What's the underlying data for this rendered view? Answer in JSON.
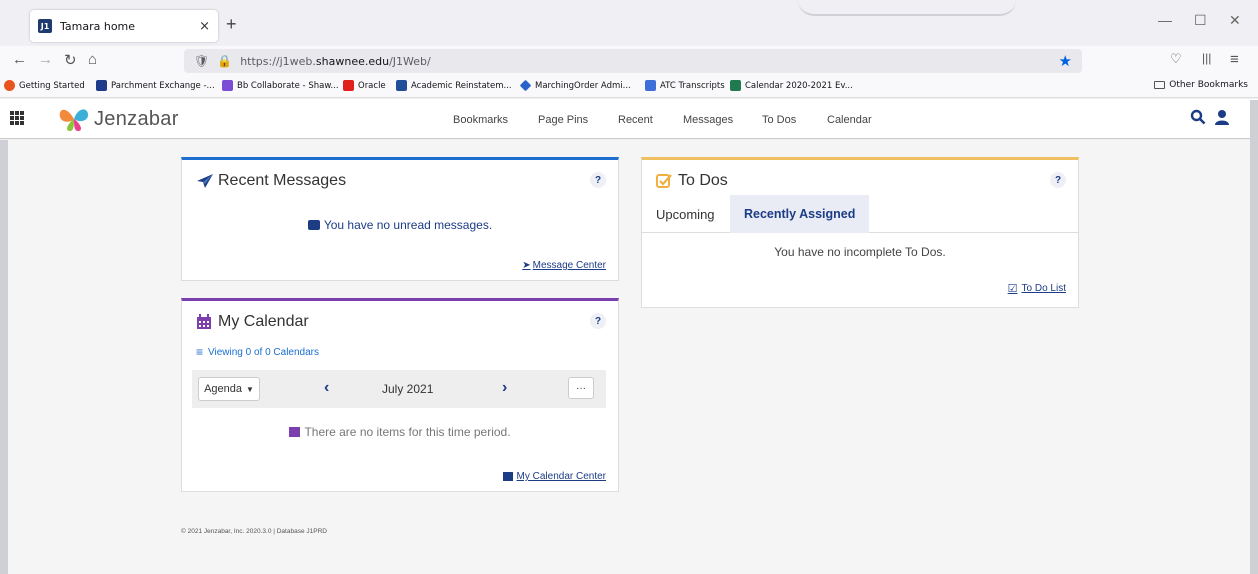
{
  "browser": {
    "tab_title": "Tamara home",
    "tab_close": "×",
    "new_tab": "+",
    "url_prefix": "https://j1web.",
    "url_host": "shawnee.edu",
    "url_path": "/J1Web/",
    "bookmarks": [
      {
        "label": "Getting Started",
        "color": "#e8541e"
      },
      {
        "label": "Parchment Exchange -...",
        "color": "#1e3a8a"
      },
      {
        "label": "Bb Collaborate - Shaw...",
        "color": "#7b4dd6"
      },
      {
        "label": "Oracle",
        "color": "#e0201b"
      },
      {
        "label": "Academic Reinstatem...",
        "color": "#1e4e9a"
      },
      {
        "label": "MarchingOrder Admi...",
        "color": "#2a62c9"
      },
      {
        "label": "ATC Transcripts",
        "color": "#3f6fd8"
      },
      {
        "label": "Calendar 2020-2021 Ev...",
        "color": "#1f7a4d"
      }
    ],
    "other_bookmarks": "Other Bookmarks"
  },
  "app": {
    "logo_text": "Jenzabar",
    "nav": [
      "Bookmarks",
      "Page Pins",
      "Recent",
      "Messages",
      "To Dos",
      "Calendar"
    ]
  },
  "recent_messages": {
    "title": "Recent Messages",
    "help": "?",
    "empty": "You have no unread messages.",
    "link": "Message Center"
  },
  "todos": {
    "title": "To Dos",
    "help": "?",
    "tabs": [
      "Upcoming",
      "Recently Assigned"
    ],
    "empty": "You have no incomplete To Dos.",
    "link": "To Do List"
  },
  "calendar": {
    "title": "My Calendar",
    "help": "?",
    "viewing": "Viewing 0 of 0 Calendars",
    "view_mode": "Agenda",
    "month": "July 2021",
    "more": "···",
    "empty": "There are no items for this time period.",
    "link": "My Calendar Center"
  },
  "footer": "© 2021 Jenzabar, Inc.  2020.3.0 | Database J1PRD",
  "colors": {
    "accent_blue": "#1c6fd1",
    "calendar_purple": "#7b3fae",
    "todo_gold": "#f0c060",
    "navy": "#1c3c86"
  }
}
